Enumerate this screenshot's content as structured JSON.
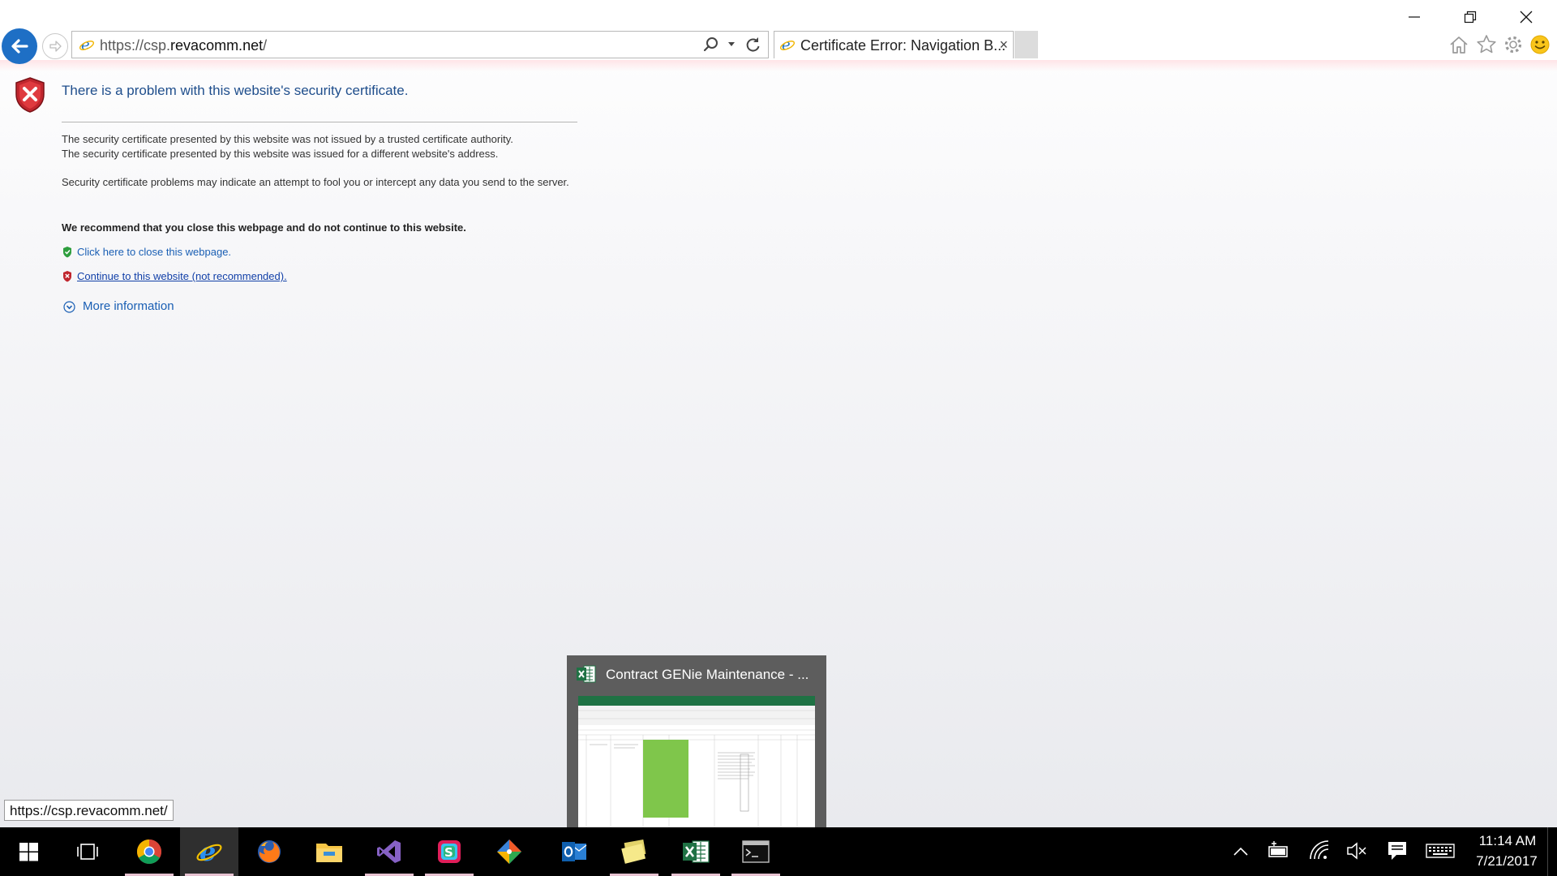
{
  "browser": {
    "address_prefix": "https://csp.",
    "address_domain": "revacomm.net",
    "address_suffix": "/",
    "tab_title": "Certificate Error: Navigation B...",
    "tab_close": "×"
  },
  "error_page": {
    "title": "There is a problem with this website's security certificate.",
    "line1": "The security certificate presented by this website was not issued by a trusted certificate authority.",
    "line2": "The security certificate presented by this website was issued for a different website's address.",
    "warning": "Security certificate problems may indicate an attempt to fool you or intercept any data you send to the server.",
    "recommendation": "We recommend that you close this webpage and do not continue to this website.",
    "close_link": "Click here to close this webpage.",
    "continue_link": "Continue to this website (not recommended).",
    "more_info": "More information"
  },
  "status_bar": {
    "url": "https://csp.revacomm.net/"
  },
  "taskbar_preview": {
    "title": "Contract GENie Maintenance - ..."
  },
  "taskbar": {
    "apps": [
      "start",
      "task-view",
      "chrome",
      "internet-explorer",
      "firefox",
      "file-explorer",
      "visual-studio",
      "slack",
      "git-tool",
      "outlook",
      "sticky-notes",
      "excel",
      "command-prompt"
    ],
    "active_app": "internet-explorer",
    "time": "11:14 AM",
    "date": "7/21/2017"
  },
  "colors": {
    "accent": "#1e6fc5",
    "link": "#1a5fb4",
    "title_blue": "#1f4e8c",
    "error_red": "#c0262e",
    "excel_green": "#1f7244"
  }
}
